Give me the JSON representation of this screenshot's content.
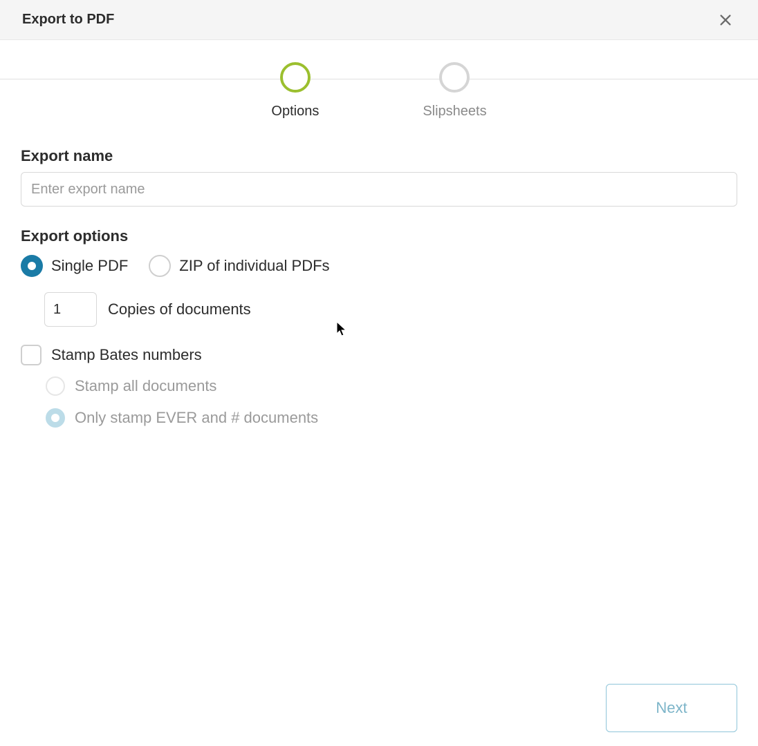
{
  "header": {
    "title": "Export to PDF"
  },
  "stepper": {
    "steps": [
      {
        "label": "Options",
        "active": true
      },
      {
        "label": "Slipsheets",
        "active": false
      }
    ]
  },
  "exportName": {
    "label": "Export name",
    "placeholder": "Enter export name",
    "value": ""
  },
  "exportOptions": {
    "label": "Export options",
    "pdfType": {
      "options": [
        {
          "label": "Single PDF",
          "selected": true
        },
        {
          "label": "ZIP of individual PDFs",
          "selected": false
        }
      ]
    },
    "copies": {
      "value": "1",
      "label": "Copies of documents"
    },
    "stampBates": {
      "label": "Stamp Bates numbers",
      "checked": false,
      "subOptions": [
        {
          "label": "Stamp all documents",
          "selected": false
        },
        {
          "label": "Only stamp EVER and # documents",
          "selected": true
        }
      ]
    }
  },
  "footer": {
    "nextLabel": "Next"
  }
}
